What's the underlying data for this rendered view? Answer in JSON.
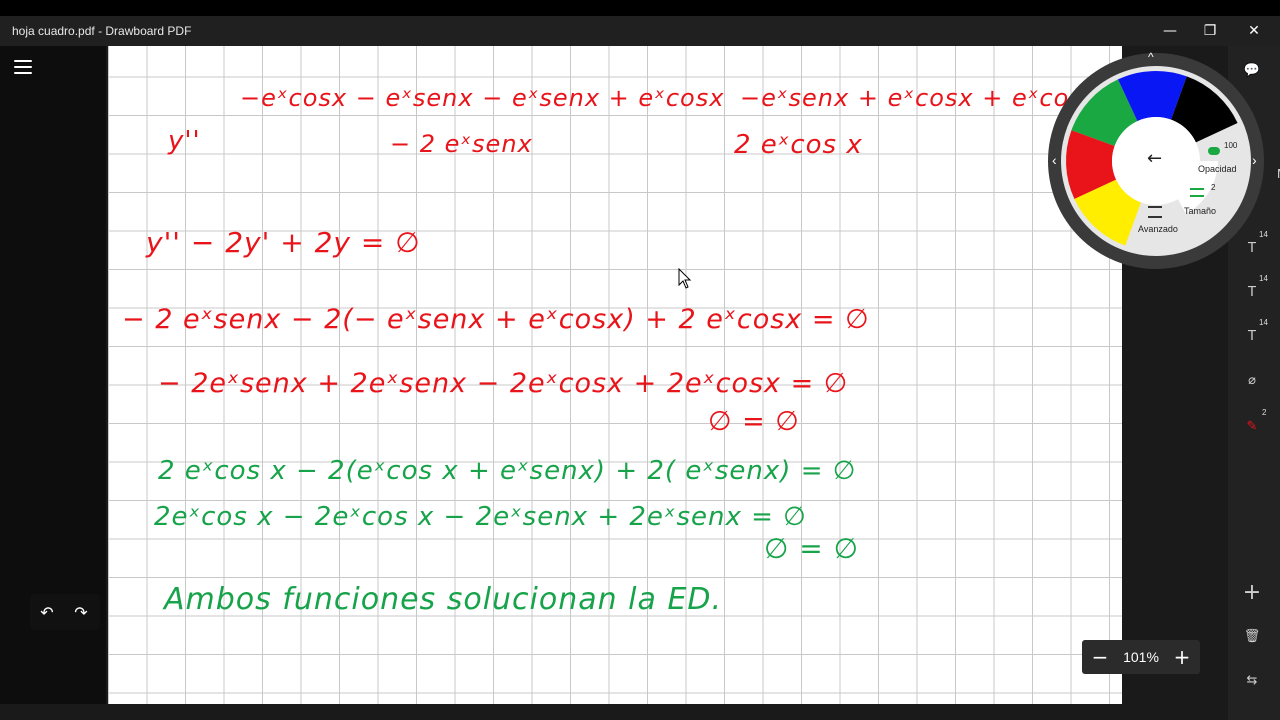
{
  "window": {
    "title": "hoja cuadro.pdf - Drawboard PDF",
    "minimize_glyph": "—",
    "maximize_glyph": "❐",
    "close_glyph": "✕"
  },
  "toolbar": {
    "undo_glyph": "↶",
    "redo_glyph": "↷"
  },
  "notes": {
    "red": [
      "y''",
      "−eˣcosx − eˣsenx − eˣsenx + eˣcosx",
      "−eˣsenx + eˣcosx + eˣcosx + e",
      "− 2 eˣsenx",
      "2 eˣcos x",
      "y'' − 2y' + 2y = ∅",
      "− 2 eˣsenx − 2(− eˣsenx + eˣcosx) + 2 eˣcosx = ∅",
      "− 2eˣsenx + 2eˣsenx − 2eˣcosx + 2eˣcosx = ∅",
      "∅ = ∅"
    ],
    "green": [
      "2 eˣcos x − 2(eˣcos x + eˣsenx) + 2( eˣsenx) = ∅",
      "2eˣcos x − 2eˣcos x − 2eˣsenx + 2eˣsenx = ∅",
      "∅ = ∅",
      "Ambos  funciones  solucionan  la  ED."
    ]
  },
  "color_wheel": {
    "colors": [
      "#1aa842",
      "#0a17f5",
      "#000000",
      "#e8141a",
      "#ffee00"
    ],
    "back_glyph": "←",
    "up_glyph": "^",
    "left_glyph": "‹",
    "right_glyph": "›",
    "opacity_label": "Opacidad",
    "opacity_value": "100",
    "size_label": "Tamaño",
    "size_value": "2",
    "advanced_label": "Avanzado"
  },
  "right_tools": {
    "edge_letter": "M",
    "comment_glyph": "💬",
    "text_glyph": "T",
    "text_size": "14",
    "lasso_glyph": "⌀",
    "pen_glyph": "✎",
    "pen_size": "2",
    "add_glyph": "+",
    "delete_glyph": "🗑",
    "swap_glyph": "⇆"
  },
  "zoom": {
    "minus": "−",
    "value": "101%",
    "plus": "+"
  }
}
